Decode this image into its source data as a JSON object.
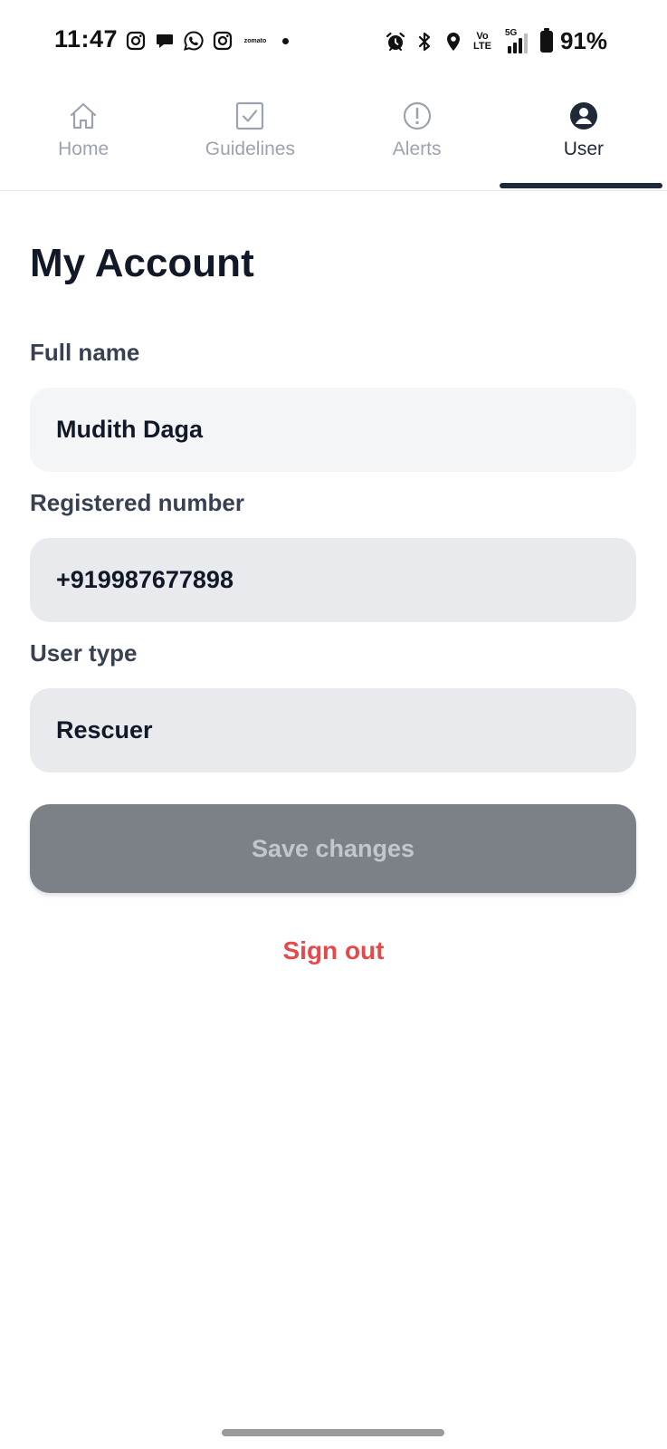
{
  "status_bar": {
    "time": "11:47",
    "left_icons": [
      "instagram-icon",
      "chat-bubble-icon",
      "whatsapp-icon",
      "instagram-icon",
      "zomato-icon",
      "notification-dot"
    ],
    "zomato_text": "zomato",
    "right_icons": [
      "alarm-icon",
      "bluetooth-icon",
      "location-icon",
      "volte-icon",
      "signal-5g-icon",
      "battery-icon"
    ],
    "volte_top": "Vo",
    "volte_bottom": "LTE",
    "network": "5G",
    "battery": "91%"
  },
  "tabs": [
    {
      "label": "Home",
      "icon": "home-icon",
      "active": false
    },
    {
      "label": "Guidelines",
      "icon": "checkbox-icon",
      "active": false
    },
    {
      "label": "Alerts",
      "icon": "alert-circle-icon",
      "active": false
    },
    {
      "label": "User",
      "icon": "user-circle-icon",
      "active": true
    }
  ],
  "account": {
    "title": "My Account",
    "full_name_label": "Full name",
    "full_name_value": "Mudith Daga",
    "number_label": "Registered number",
    "number_value": "+919987677898",
    "user_type_label": "User type",
    "user_type_value": "Rescuer",
    "save_label": "Save changes",
    "signout_label": "Sign out"
  },
  "colors": {
    "accent": "#1f2937",
    "muted_tab": "#9ca3af",
    "save_button_bg": "#7c8087",
    "sign_out": "#e24b4b"
  }
}
